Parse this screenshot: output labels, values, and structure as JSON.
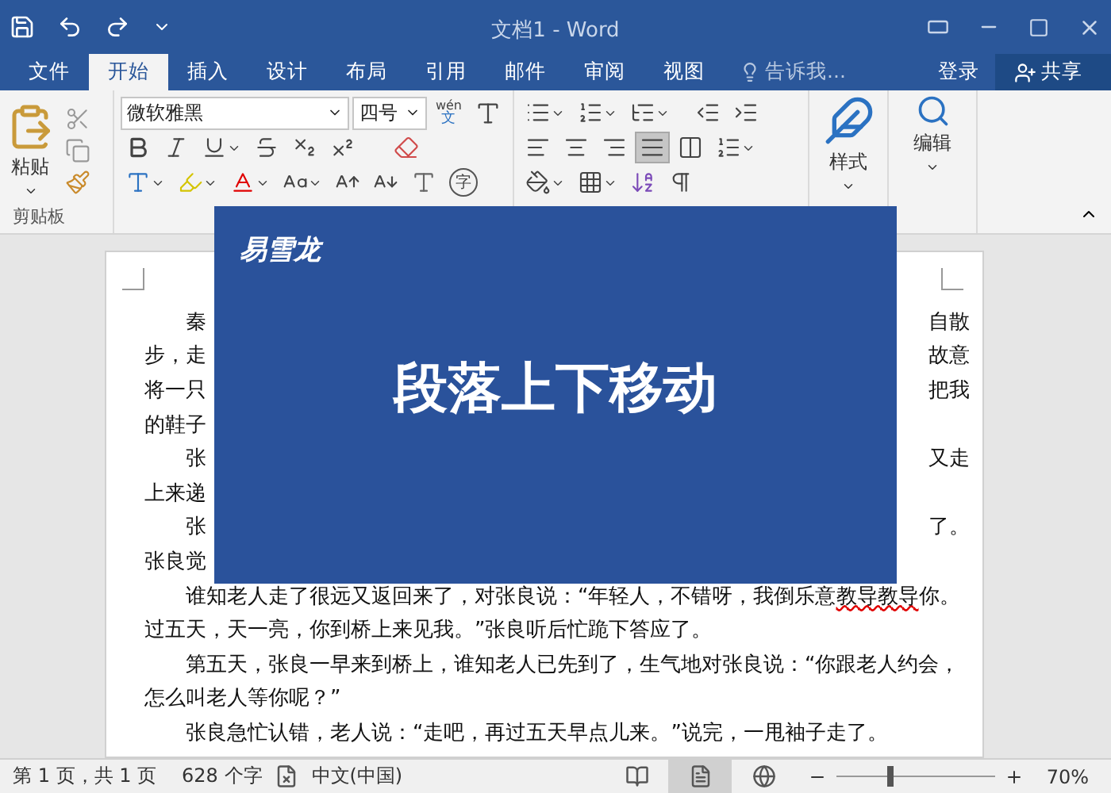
{
  "window": {
    "title": "文档1 - Word"
  },
  "tabs": [
    {
      "label": "文件",
      "selected": false
    },
    {
      "label": "开始",
      "selected": true
    },
    {
      "label": "插入",
      "selected": false
    },
    {
      "label": "设计",
      "selected": false
    },
    {
      "label": "布局",
      "selected": false
    },
    {
      "label": "引用",
      "selected": false
    },
    {
      "label": "邮件",
      "selected": false
    },
    {
      "label": "审阅",
      "selected": false
    },
    {
      "label": "视图",
      "selected": false
    }
  ],
  "tell_me": {
    "placeholder": "告诉我..."
  },
  "sign_in": "登录",
  "share": "共享",
  "ribbon": {
    "paste": "粘贴",
    "clipboard_label": "剪贴板",
    "font_name": "微软雅黑",
    "font_size": "四号",
    "phonetic_top": "wén",
    "phonetic_bottom": "文",
    "enclose_char": "字",
    "alignments": [
      {
        "selected": false
      },
      {
        "selected": false
      },
      {
        "selected": false
      },
      {
        "selected": true
      },
      {
        "selected": false
      }
    ],
    "styles": "样式",
    "editing": "编辑"
  },
  "document": {
    "lines": [
      {
        "indent": true,
        "text": "秦",
        "right": "自散"
      },
      {
        "indent": false,
        "text": "步，走",
        "right": "故意"
      },
      {
        "indent": false,
        "text": "将一只",
        "right": "把我"
      },
      {
        "indent": false,
        "text": "的鞋子"
      },
      {
        "indent": true,
        "text": "张",
        "right": "又走"
      },
      {
        "indent": false,
        "text": "上来递"
      },
      {
        "indent": true,
        "text": "张",
        "right": "了。"
      },
      {
        "indent": false,
        "text": "张良觉"
      },
      {
        "indent": true,
        "parts": [
          {
            "text": "谁知老人走了很远又返回来了，对张良说：“年轻人，不错呀，我倒乐意",
            "flagged": false
          },
          {
            "text": "教导教导",
            "flagged": true
          },
          {
            "text": "你。",
            "flagged": false
          }
        ]
      },
      {
        "indent": false,
        "text": "过五天，天一亮，你到桥上来见我。”张良听后忙跪下答应了。"
      },
      {
        "indent": true,
        "text": "第五天，张良一早来到桥上，谁知老人已先到了，生气地对张良说：“你跟老人约会，"
      },
      {
        "indent": false,
        "text": "怎么叫老人等你呢？”"
      },
      {
        "indent": true,
        "text": "张良急忙认错，老人说：“走吧，再过五天早点儿来。”说完，一甩袖子走了。"
      }
    ]
  },
  "overlay": {
    "brand": "易雪龙",
    "heading": "段落上下移动"
  },
  "status_bar": {
    "page": "第 1 页，共 1 页",
    "words": "628 个字",
    "language": "中文(中国)",
    "views": [
      {
        "selected": false
      },
      {
        "selected": true
      },
      {
        "selected": false
      }
    ],
    "zoom": {
      "level": 0.34,
      "reading": "70%"
    }
  }
}
